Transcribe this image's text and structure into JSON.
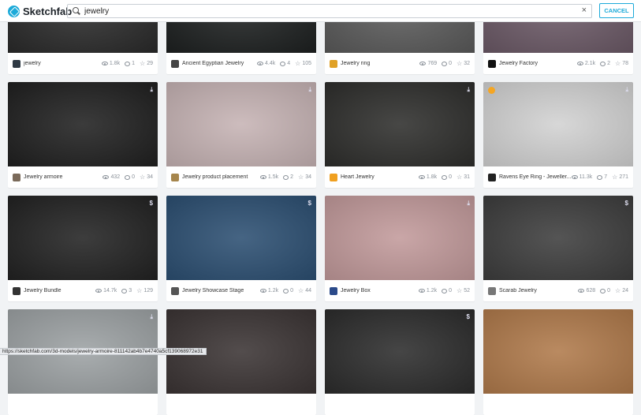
{
  "app": {
    "name": "Sketchfab"
  },
  "search": {
    "value": "jewelry",
    "cancel_label": "CANCEL"
  },
  "status_url": "https://sketchfab.com/3d-models/jewelry-armoire-811142ab4b7e4740a5cf139068972e31",
  "cards": [
    {
      "title": "jewelry",
      "views": "1.8k",
      "comments": "1",
      "likes": "29",
      "corner": "",
      "thumb": "#2a2a2a"
    },
    {
      "title": "Ancient Egyptian Jewelry",
      "views": "4.4k",
      "comments": "4",
      "likes": "105",
      "corner": "",
      "thumb": "#1d2020"
    },
    {
      "title": "Jewelry ring",
      "views": "769",
      "comments": "0",
      "likes": "32",
      "corner": "",
      "thumb": "#5a5a5a"
    },
    {
      "title": "Jewelry Factory",
      "views": "2.1k",
      "comments": "2",
      "likes": "78",
      "corner": "",
      "thumb": "#6b5966"
    },
    {
      "title": "Jewelry armoire",
      "views": "432",
      "comments": "0",
      "likes": "34",
      "corner": "download",
      "thumb": "#202020"
    },
    {
      "title": "Jewelry product placement",
      "views": "1.5k",
      "comments": "2",
      "likes": "34",
      "corner": "download",
      "thumb": "#c6b3b4"
    },
    {
      "title": "Heart Jewelry",
      "views": "1.8k",
      "comments": "0",
      "likes": "31",
      "corner": "download",
      "thumb": "#2e2e2c"
    },
    {
      "title": "Ravens Eye Ring - Jeweller...",
      "views": "11.3k",
      "comments": "7",
      "likes": "271",
      "corner": "download",
      "thumb": "#d2d2d2"
    },
    {
      "title": "Jewelry Bundle",
      "views": "14.7k",
      "comments": "3",
      "likes": "129",
      "corner": "$",
      "thumb": "#222222"
    },
    {
      "title": "Jewelry Showcase Stage",
      "views": "1.2k",
      "comments": "0",
      "likes": "44",
      "corner": "$",
      "thumb": "#2c4f72"
    },
    {
      "title": "Jewelry Box",
      "views": "1.2k",
      "comments": "0",
      "likes": "52",
      "corner": "download",
      "thumb": "#c29a9b"
    },
    {
      "title": "Scarab Jewelry",
      "views": "628",
      "comments": "0",
      "likes": "24",
      "corner": "$",
      "thumb": "#3d3d3d"
    },
    {
      "title": "",
      "views": "",
      "comments": "",
      "likes": "",
      "corner": "download",
      "thumb": "#9da2a4"
    },
    {
      "title": "",
      "views": "",
      "comments": "",
      "likes": "",
      "corner": "",
      "thumb": "#3b3434"
    },
    {
      "title": "",
      "views": "",
      "comments": "",
      "likes": "",
      "corner": "$",
      "thumb": "#2c2c2c"
    },
    {
      "title": "",
      "views": "",
      "comments": "",
      "likes": "",
      "corner": "",
      "thumb": "#b07a4b"
    }
  ],
  "colors": {
    "accent": "#1caad9"
  }
}
